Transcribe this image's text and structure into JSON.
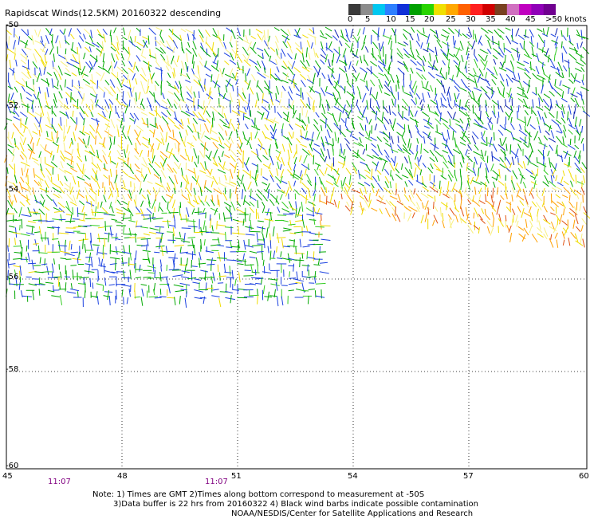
{
  "title": "Rapidscat Winds(12.5KM) 20160322 descending",
  "colorbar": {
    "labels": [
      "0",
      "5",
      "10",
      "15",
      "20",
      "25",
      "30",
      "35",
      "40",
      "45",
      ">50 knots"
    ],
    "colors": [
      "#3a3a3a",
      "#8c8c8c",
      "#00c8f0",
      "#2d7fff",
      "#1030d8",
      "#00a000",
      "#28d400",
      "#f0e000",
      "#ffa800",
      "#ff6000",
      "#ff2020",
      "#d00000",
      "#784020",
      "#d070c0",
      "#c000c0",
      "#9000b8",
      "#700090"
    ]
  },
  "axes": {
    "lon_ticks": [
      "45",
      "48",
      "51",
      "54",
      "57",
      "60"
    ],
    "lat_ticks": [
      "-50",
      "-52",
      "-54",
      "-56",
      "-58",
      "-60"
    ],
    "lon_range": [
      45,
      60
    ],
    "lat_range": [
      -50,
      -60
    ]
  },
  "times": [
    "11:07",
    "11:07"
  ],
  "notes": {
    "line1": "Note: 1) Times are GMT 2)Times along bottom correspond to measurement at -50S",
    "line2": "3)Data buffer is 22 hrs from 20160322 4) Black wind barbs indicate possible contamination",
    "line3": "NOAA/NESDIS/Center for Satellite Applications and Research"
  }
}
